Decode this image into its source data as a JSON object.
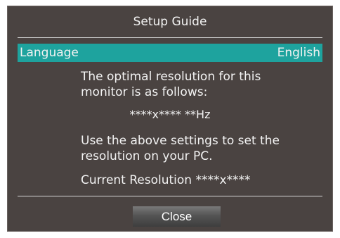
{
  "dialog": {
    "title": "Setup Guide",
    "language": {
      "label": "Language",
      "value": "English"
    },
    "message_1": "The optimal resolution for this monitor is as follows:",
    "resolution_line": "****x**** **Hz",
    "message_2": "Use the above settings to set the resolution on your PC.",
    "current_resolution": "Current Resolution ****x****",
    "close_label": "Close",
    "colors": {
      "background": "#4a4341",
      "highlight": "#1ea39e",
      "text": "#f2f2f2"
    }
  }
}
